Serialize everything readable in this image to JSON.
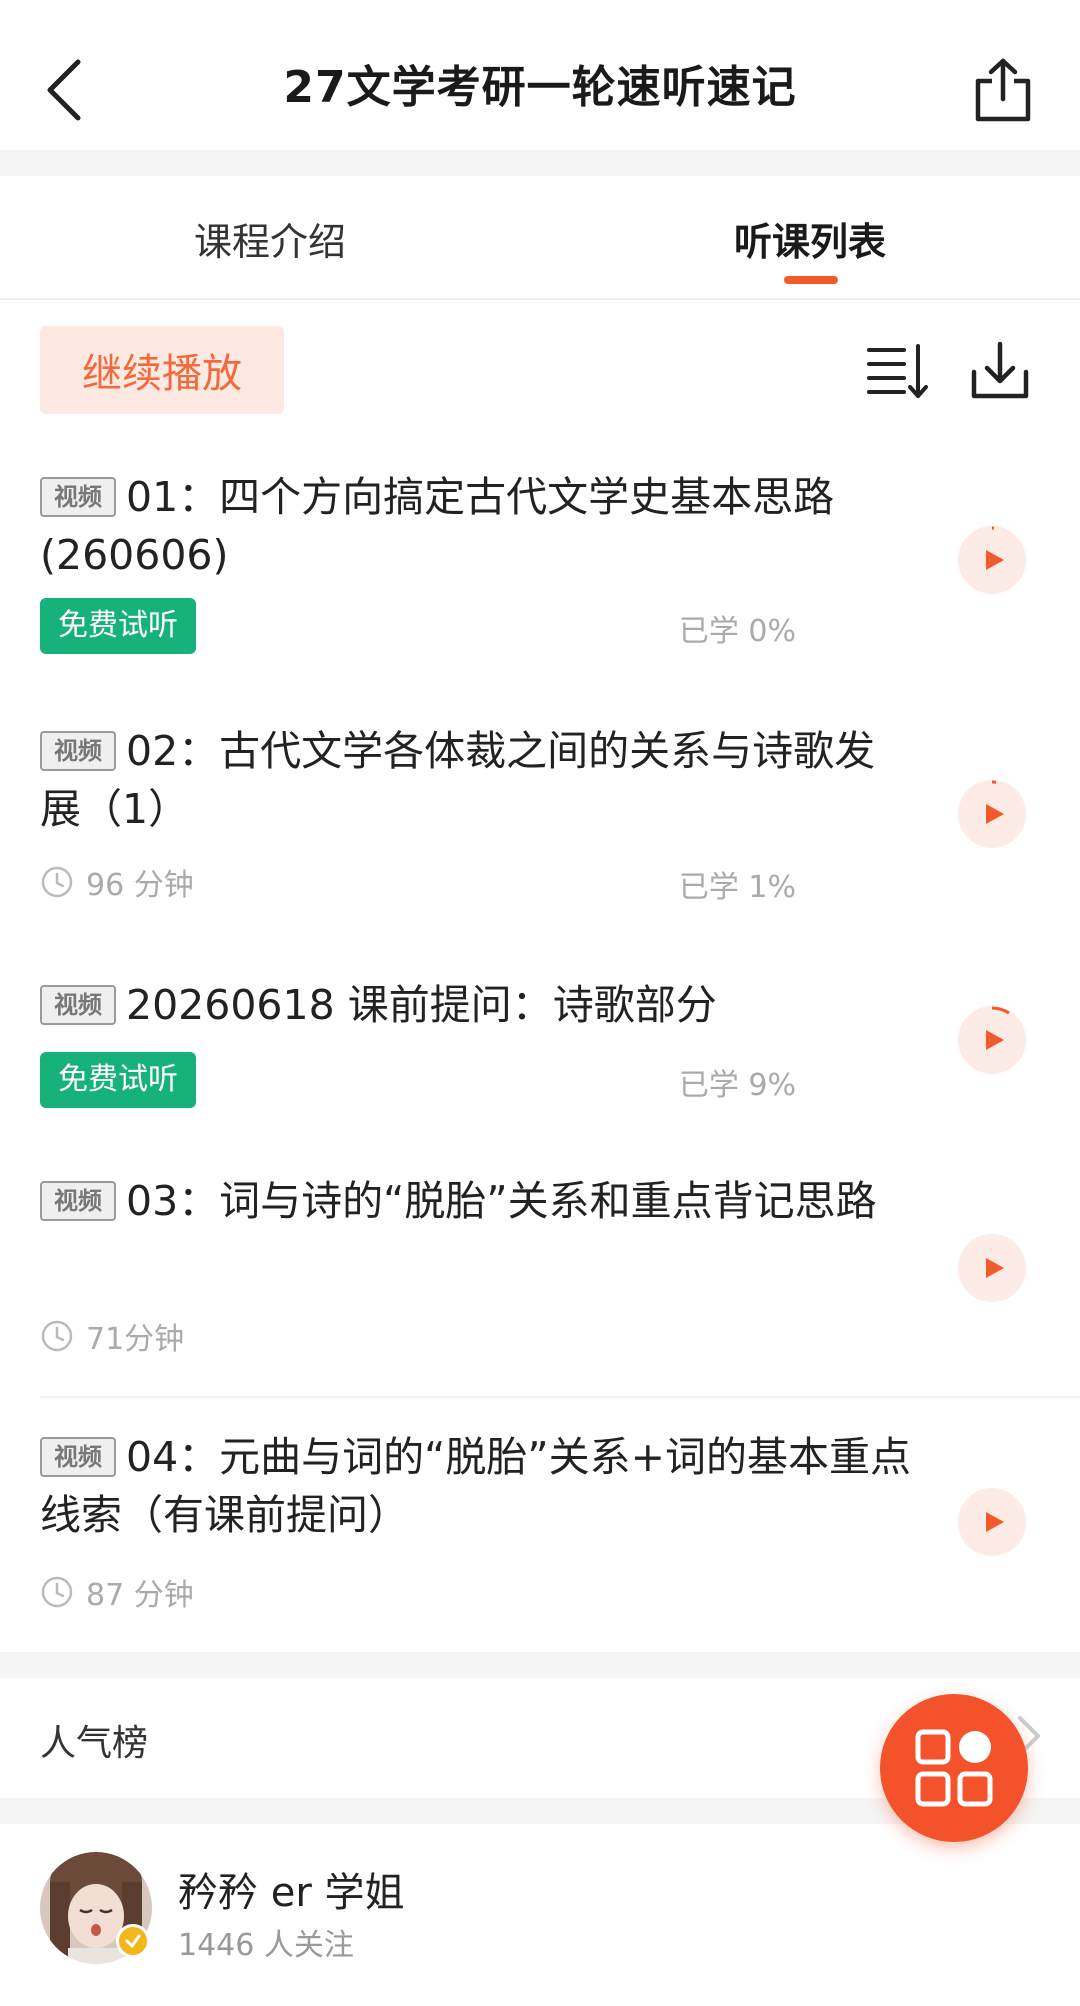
{
  "header": {
    "title": "27文学考研一轮速听速记"
  },
  "tabs": [
    {
      "label": "课程介绍",
      "active": false
    },
    {
      "label": "听课列表",
      "active": true
    }
  ],
  "toolbar": {
    "continue_label": "继续播放"
  },
  "lessons": [
    {
      "tag": "视频",
      "title": "01：四个方向搞定古代文学史基本思路(260606)",
      "free_label": "免费试听",
      "duration": "",
      "progress": "已学 0%"
    },
    {
      "tag": "视频",
      "title": "02：古代文学各体裁之间的关系与诗歌发展（1）",
      "free_label": "",
      "duration": "96 分钟",
      "progress": "已学 1%"
    },
    {
      "tag": "视频",
      "title": "20260618 课前提问：诗歌部分",
      "free_label": "免费试听",
      "duration": "",
      "progress": "已学 9%"
    },
    {
      "tag": "视频",
      "title": "03：词与诗的“脱胎”关系和重点背记思路",
      "free_label": "",
      "duration": "71分钟",
      "progress": ""
    },
    {
      "tag": "视频",
      "title": "04：元曲与词的“脱胎”关系+词的基本重点线索（有课前提问）",
      "free_label": "",
      "duration": "87 分钟",
      "progress": ""
    }
  ],
  "ranking": {
    "label": "人气榜"
  },
  "teacher": {
    "name": "矜矜 er 学姐",
    "followers": "1446 人关注"
  },
  "colors": {
    "accent": "#f25a2b",
    "free_badge": "#17b17a",
    "continue_bg": "#fde9e2"
  }
}
